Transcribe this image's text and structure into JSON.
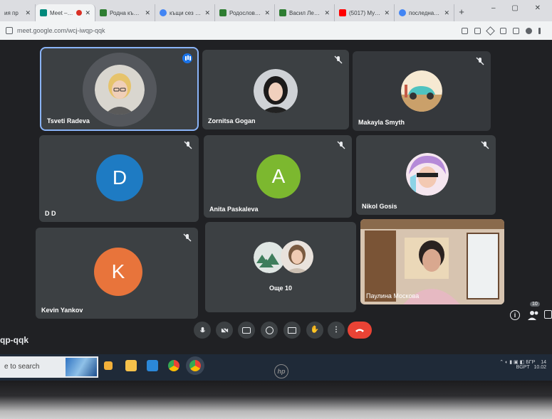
{
  "browser": {
    "tabs": [
      {
        "label": "ия пр",
        "favicon": "blank-icon",
        "color": "#9aa0a6"
      },
      {
        "label": "Meet – wcj-",
        "favicon": "meet-icon",
        "color": "#00897b",
        "active": true,
        "recording": true
      },
      {
        "label": "Родна къща – /",
        "favicon": "page-icon",
        "color": "#2e7d32"
      },
      {
        "label": "къщи сез – G",
        "favicon": "google-icon",
        "color": "#4285f4"
      },
      {
        "label": "Родословие – /",
        "favicon": "page-icon",
        "color": "#2e7d32"
      },
      {
        "label": "Васил Левски |",
        "favicon": "page-icon",
        "color": "#2e7d32"
      },
      {
        "label": "(5017) Музика",
        "favicon": "youtube-icon",
        "color": "#ff0000"
      },
      {
        "label": "последната си",
        "favicon": "google-icon",
        "color": "#4285f4"
      }
    ],
    "url": "meet.google.com/wcj-iwqp-qqk"
  },
  "participants": [
    {
      "name": "Tsveti Radeva",
      "type": "photo",
      "speaking": true
    },
    {
      "name": "Zornitsa Gogan",
      "type": "photo",
      "muted": true
    },
    {
      "name": "Makayla Smyth",
      "type": "photo",
      "muted": true
    },
    {
      "name": "D D",
      "type": "letter",
      "letter": "D",
      "color": "#1e7bc3",
      "muted": true
    },
    {
      "name": "Anita Paskaleva",
      "type": "letter",
      "letter": "A",
      "color": "#7cb82f",
      "muted": true
    },
    {
      "name": "Nikol Gosis",
      "type": "illustration",
      "muted": true
    },
    {
      "name": "Kevin Yankov",
      "type": "letter",
      "letter": "K",
      "color": "#e8743b",
      "muted": true
    },
    {
      "name": "Още 10",
      "type": "group"
    },
    {
      "name": "Паулина Москова",
      "type": "video"
    }
  ],
  "meeting": {
    "code": "qp-qqk",
    "people_count": "10"
  },
  "taskbar": {
    "search_placeholder": "e to search",
    "tray_lang": "БГР",
    "tray_sub": "BGPT",
    "tray_time": "14",
    "tray_date": "10.02"
  },
  "laptop": {
    "brand": "hp"
  }
}
